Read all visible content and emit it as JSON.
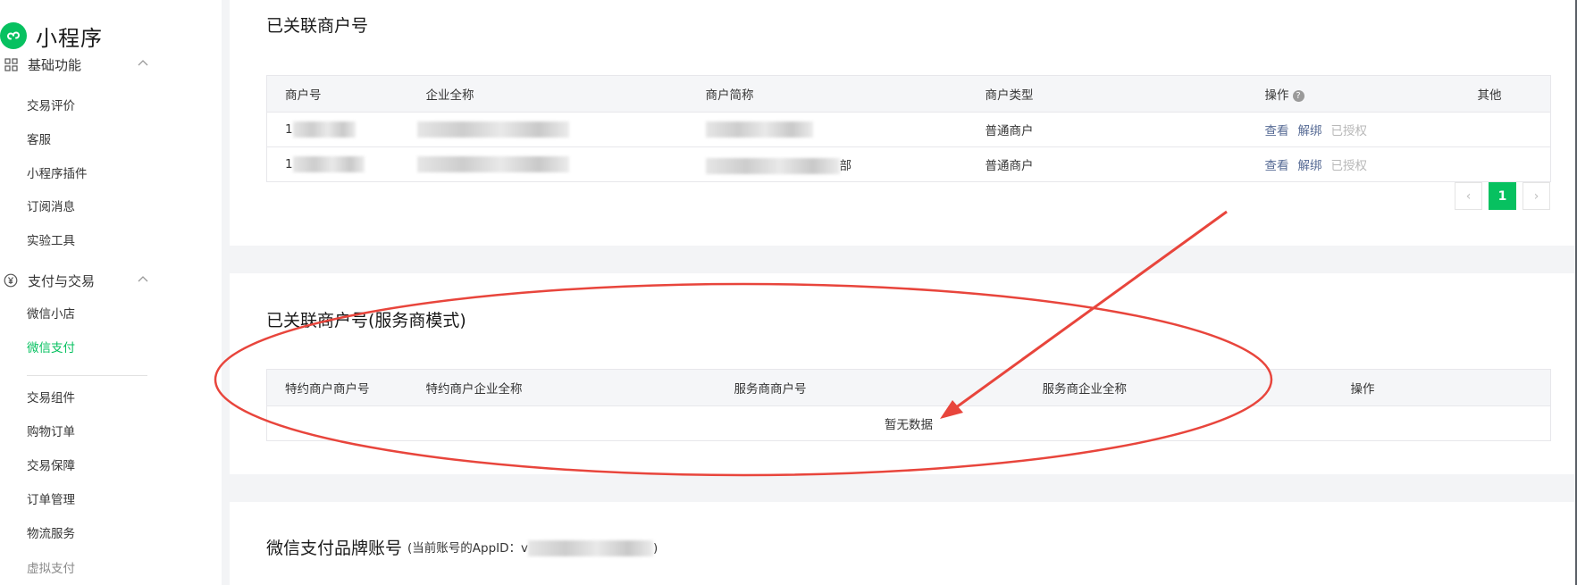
{
  "app": {
    "title": "小程序",
    "accent": "#07c160",
    "link_color": "#576b95"
  },
  "sidebar": {
    "groups": [
      {
        "label": "基础功能",
        "icon": "grid-icon",
        "items": [
          "交易评价",
          "客服",
          "小程序插件",
          "订阅消息",
          "实验工具"
        ]
      },
      {
        "label": "支付与交易",
        "icon": "yen-circle-icon",
        "items": [
          "微信小店",
          "微信支付",
          "交易组件",
          "购物订单",
          "交易保障",
          "订单管理",
          "物流服务",
          "虚拟支付"
        ]
      }
    ],
    "active_item": "微信支付"
  },
  "linked_merchants": {
    "title": "已关联商户号",
    "columns": [
      "商户号",
      "企业全称",
      "商户简称",
      "商户类型",
      "操作",
      "其他"
    ],
    "rows": [
      {
        "merchant_id": "1",
        "company_name": "",
        "short_name": "",
        "type": "普通商户",
        "actions": [
          "查看",
          "解绑",
          "已授权"
        ]
      },
      {
        "merchant_id": "1",
        "company_name": "",
        "short_name": "部",
        "type": "普通商户",
        "actions": [
          "查看",
          "解绑",
          "已授权"
        ]
      }
    ],
    "pagination": {
      "current_page": "1",
      "prev": "‹",
      "next": "›"
    }
  },
  "service_provider_merchants": {
    "title": "已关联商户号(服务商模式)",
    "columns": [
      "特约商户商户号",
      "特约商户企业全称",
      "服务商商户号",
      "服务商企业全称",
      "操作"
    ],
    "empty_text": "暂无数据"
  },
  "brand_account": {
    "title": "微信支付品牌账号",
    "subtitle_prefix": "(当前账号的AppID：",
    "appid_initial": "v",
    "subtitle_suffix": ")"
  },
  "annotation": {
    "color": "#e8453c"
  }
}
